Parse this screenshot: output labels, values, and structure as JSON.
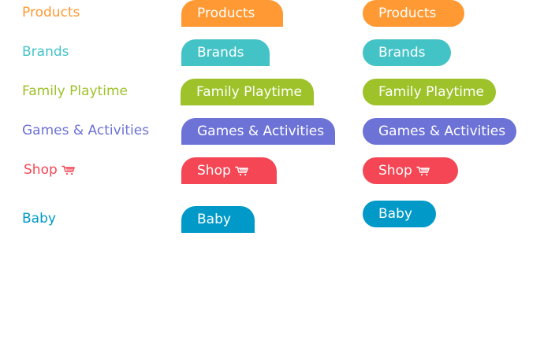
{
  "colors": {
    "products": "#ff9933",
    "brands": "#44c3c7",
    "family": "#9ec229",
    "games": "#6c72d6",
    "shop": "#f44655",
    "baby": "#0099c8"
  },
  "icons": {
    "cart": "shopping-cart-icon"
  },
  "columns": {
    "plain": {
      "products": "Products",
      "brands": "Brands",
      "family": "Family Playtime",
      "games": "Games & Activities",
      "shop": "Shop",
      "baby": "Baby"
    },
    "tabs": {
      "products": "Products",
      "brands": "Brands",
      "family": "Family Playtime",
      "games": "Games & Activities",
      "shop": "Shop",
      "baby": "Baby"
    },
    "pills": {
      "products": "Products",
      "brands": "Brands",
      "family": "Family Playtime",
      "games": "Games & Activities",
      "shop": "Shop",
      "baby": "Baby"
    }
  }
}
